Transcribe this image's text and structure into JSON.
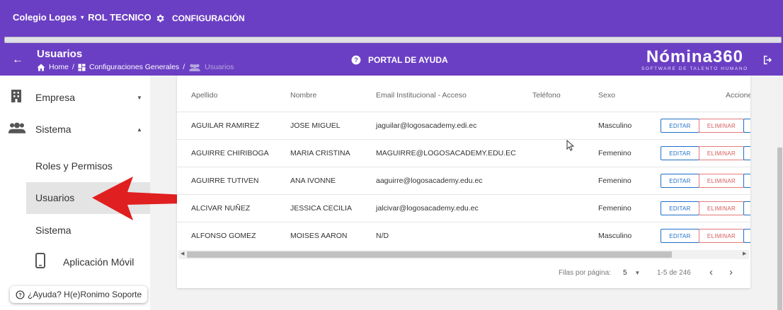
{
  "topbar": {
    "org_name": "Colegio Logos",
    "role": "ROL TECNICO",
    "config_label": "CONFIGURACIÓN"
  },
  "subbar": {
    "title": "Usuarios",
    "breadcrumb": [
      "Home",
      "/",
      "Configuraciones Generales",
      "/",
      "Usuarios"
    ],
    "help_label": "PORTAL DE AYUDA",
    "brand_name": "Nómina360",
    "brand_tagline": "SOFTWARE DE TALENTO HUMANO"
  },
  "sidebar": {
    "items": [
      {
        "label": "Empresa",
        "icon": "building-icon"
      },
      {
        "label": "Sistema",
        "icon": "people-icon"
      },
      {
        "label": "Roles y Permisos"
      },
      {
        "label": "Usuarios"
      },
      {
        "label": "Sistema"
      },
      {
        "label": "Aplicación Móvil",
        "icon": "phone-icon"
      }
    ],
    "help_pill": "¿Ayuda? H(e)Ronimo Soporte"
  },
  "table": {
    "headers": [
      "Apellido",
      "Nombre",
      "Email Institucional - Acceso",
      "Teléfono",
      "Sexo",
      "Accione"
    ],
    "edit_label": "EDITAR",
    "delete_label": "ELIMINAR",
    "rows": [
      {
        "apellido": "AGUILAR RAMIREZ",
        "nombre": "JOSE MIGUEL",
        "email": "jaguilar@logosacademy.edi.ec",
        "telefono": "",
        "sexo": "Masculino"
      },
      {
        "apellido": "AGUIRRE CHIRIBOGA",
        "nombre": "MARIA CRISTINA",
        "email": "MAGUIRRE@LOGOSACADEMY.EDU.EC",
        "telefono": "",
        "sexo": "Femenino"
      },
      {
        "apellido": "AGUIRRE TUTIVEN",
        "nombre": "ANA IVONNE",
        "email": "aaguirre@logosacademy.edu.ec",
        "telefono": "",
        "sexo": "Femenino"
      },
      {
        "apellido": "ALCIVAR NUÑEZ",
        "nombre": "JESSICA CECILIA",
        "email": "jalcivar@logosacademy.edu.ec",
        "telefono": "",
        "sexo": "Femenino"
      },
      {
        "apellido": "ALFONSO GOMEZ",
        "nombre": "MOISES AARON",
        "email": "N/D",
        "telefono": "",
        "sexo": "Masculino"
      }
    ],
    "rows_per_page_label": "Filas por página:",
    "rows_per_page": "5",
    "range_label": "1-5 de 246"
  },
  "colors": {
    "brand_purple": "#6b3fc4",
    "edit_blue": "#1e6fc7",
    "delete_red": "#d65a5a",
    "annotation_red": "#e02020"
  }
}
